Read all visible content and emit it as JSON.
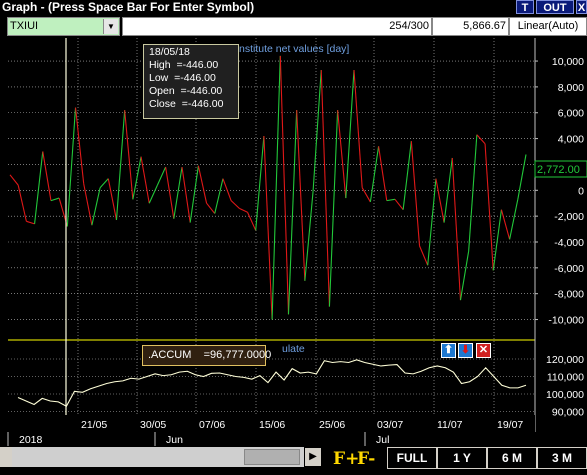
{
  "window": {
    "title": "Graph  - (Press Space Bar For Enter Symbol)",
    "btn_t": "T",
    "btn_out": "OUT",
    "btn_x": "X"
  },
  "toolbar": {
    "symbol": "TXIUI",
    "count": "254/300",
    "value": "5,866.67",
    "scale": "Linear(Auto)"
  },
  "main_chart": {
    "legend": "Futures-Institute net values [day]",
    "y_ticks": [
      "10,000",
      "8,000",
      "6,000",
      "4,000",
      "2,000",
      "0",
      "-2,000",
      "-4,000",
      "-6,000",
      "-8,000",
      "-10,000"
    ],
    "last_value": "2,772.00"
  },
  "tooltip": {
    "date": "18/05/18",
    "high_label": "High",
    "high": "=-446.00",
    "low_label": "Low",
    "low": "=-446.00",
    "open_label": "Open",
    "open": "=-446.00",
    "close_label": "Close",
    "close": "=-446.00"
  },
  "indicator": {
    "label": ".ACCUM",
    "value": "=96,777.0000",
    "legend_suffix": "ulate",
    "y_ticks": [
      "120,000",
      "110,000",
      "100,000",
      "90,000"
    ]
  },
  "x_axis": {
    "dates": [
      "21/05",
      "30/05",
      "07/06",
      "15/06",
      "25/06",
      "03/07",
      "11/07",
      "19/07"
    ],
    "periods": [
      "2018",
      "Jun",
      "Jul"
    ]
  },
  "bottom": {
    "full": "FULL",
    "y1": "1 Y",
    "m6": "6 M",
    "m3": "3 M",
    "f_plus": "F+",
    "f_minus": "F-"
  },
  "colors": {
    "up": "#22c83a",
    "down": "#e01818",
    "accum": "#ffffd8",
    "grid": "#c0c0c0"
  },
  "chart_data": {
    "type": "line",
    "title": "Futures-Institute net values [day]",
    "ylim": [
      -10500,
      10700
    ],
    "series": [
      {
        "name": "Futures-Institute net values",
        "values": [
          1200,
          400,
          -2400,
          -2600,
          3000,
          -800,
          -600,
          -2800,
          6400,
          500,
          -2700,
          200,
          900,
          -2300,
          6200,
          -700,
          2600,
          -1000,
          400,
          1800,
          -2200,
          1800,
          -2500,
          1900,
          -1000,
          -1800,
          900,
          -800,
          -1400,
          -1700,
          -3100,
          4200,
          -10000,
          10400,
          -9600,
          6200,
          -7000,
          -100,
          9300,
          -9000,
          6200,
          -600,
          9300,
          200,
          -900,
          3400,
          -800,
          -700,
          -1500,
          3800,
          -4300,
          -5800,
          900,
          -2500,
          2500,
          -8500,
          -4700,
          4300,
          3600,
          -6200,
          -1500,
          -3800,
          -700,
          2772
        ]
      }
    ]
  },
  "indicator_data": {
    "type": "line",
    "ylim": [
      88000,
      124000
    ],
    "values": [
      98000,
      96000,
      94000,
      97500,
      96000,
      95500,
      93000,
      101500,
      101000,
      103000,
      104500,
      106000,
      107000,
      107500,
      109000,
      108500,
      110000,
      111500,
      110500,
      111000,
      112500,
      113000,
      111000,
      110000,
      111800,
      112000,
      111000,
      110000,
      109500,
      108500,
      110500,
      106500,
      112500,
      108000,
      114500,
      112000,
      112500,
      111500,
      119000,
      118000,
      118500,
      118000,
      119500,
      118000,
      117000,
      116000,
      116500,
      116800,
      112000,
      111500,
      113000,
      115000,
      116000,
      115000,
      112500,
      106000,
      107000,
      110000,
      115000,
      110000,
      105000,
      103500,
      103500,
      105000
    ]
  }
}
